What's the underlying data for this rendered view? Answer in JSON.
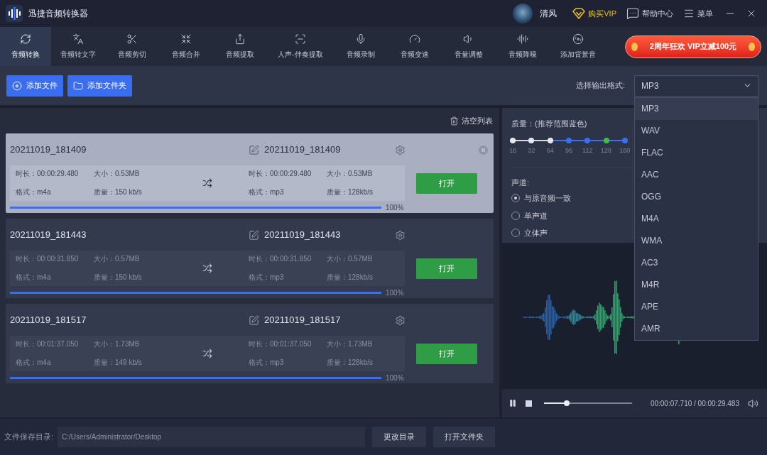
{
  "app": {
    "title": "迅捷音频转换器"
  },
  "user": {
    "name": "清风"
  },
  "header_links": [
    {
      "kind": "vip",
      "label": "购买VIP"
    },
    {
      "kind": "help",
      "label": "帮助中心"
    },
    {
      "kind": "menu",
      "label": "菜单"
    }
  ],
  "tabs": [
    {
      "label": "音频转换",
      "selected": true
    },
    {
      "label": "音频转文字",
      "selected": false
    },
    {
      "label": "音频剪切",
      "selected": false
    },
    {
      "label": "音频合并",
      "selected": false
    },
    {
      "label": "音频提取",
      "selected": false
    },
    {
      "label": "人声-伴奏提取",
      "selected": false
    },
    {
      "label": "音频录制",
      "selected": false
    },
    {
      "label": "音频变速",
      "selected": false
    },
    {
      "label": "音量调整",
      "selected": false
    },
    {
      "label": "音频降噪",
      "selected": false
    },
    {
      "label": "添加背景音",
      "selected": false
    }
  ],
  "promo": {
    "label": "2周年狂欢 VIP立减100元"
  },
  "actions": [
    {
      "kind": "add_file",
      "label": "添加文件"
    },
    {
      "kind": "add_folder",
      "label": "添加文件夹"
    }
  ],
  "format_select": {
    "label": "选择输出格式:",
    "value": "MP3",
    "expanded": true,
    "options": [
      {
        "label": "MP3",
        "selected": true
      },
      {
        "label": "WAV",
        "selected": false
      },
      {
        "label": "FLAC",
        "selected": false
      },
      {
        "label": "AAC",
        "selected": false
      },
      {
        "label": "OGG",
        "selected": false
      },
      {
        "label": "M4A",
        "selected": false
      },
      {
        "label": "WMA",
        "selected": false
      },
      {
        "label": "AC3",
        "selected": false
      },
      {
        "label": "M4R",
        "selected": false
      },
      {
        "label": "APE",
        "selected": false
      },
      {
        "label": "AMR",
        "selected": false
      }
    ]
  },
  "clear_list": {
    "label": "清空列表"
  },
  "files": [
    {
      "selected": true,
      "source": {
        "name": "20211019_181409",
        "duration": "时长：00:00:29.480",
        "size": "大小：0.53MB",
        "format": "格式：m4a",
        "quality": "质量：150 kb/s"
      },
      "output": {
        "name": "20211019_181409",
        "duration": "时长：00:00:29.480",
        "size": "大小：0.53MB",
        "format": "格式：mp3",
        "quality": "质量：128kb/s"
      },
      "open_button": "打开",
      "level": 1,
      "percent": "100%"
    },
    {
      "selected": false,
      "source": {
        "name": "20211019_181443",
        "duration": "时长：00:00:31.850",
        "size": "大小：0.57MB",
        "format": "格式：m4a",
        "quality": "质量：150 kb/s"
      },
      "output": {
        "name": "20211019_181443",
        "duration": "时长：00:00:31.850",
        "size": "大小：0.57MB",
        "format": "格式：mp3",
        "quality": "质量：128kb/s"
      },
      "open_button": "打开",
      "level": 1,
      "percent": "100%"
    },
    {
      "selected": false,
      "source": {
        "name": "20211019_181517",
        "duration": "时长：00:01:37.050",
        "size": "大小：1.73MB",
        "format": "格式：m4a",
        "quality": "质量：149 kb/s"
      },
      "output": {
        "name": "20211019_181517",
        "duration": "时长：00:01:37.050",
        "size": "大小：1.73MB",
        "format": "格式：mp3",
        "quality": "质量：128kb/s"
      },
      "open_button": "打开",
      "level": 1,
      "percent": "100%"
    }
  ],
  "quality": {
    "label": "质量：(推荐范围蓝色)",
    "ticks": [
      {
        "label": "16",
        "recommended": false,
        "selected": false
      },
      {
        "label": "32",
        "recommended": false,
        "selected": false
      },
      {
        "label": "64",
        "recommended": false,
        "selected": false
      },
      {
        "label": "96",
        "recommended": true,
        "selected": false
      },
      {
        "label": "112",
        "recommended": true,
        "selected": false
      },
      {
        "label": "128",
        "recommended": true,
        "selected": true
      },
      {
        "label": "160",
        "recommended": true,
        "selected": false
      }
    ]
  },
  "channel": {
    "label": "声道:",
    "options": [
      {
        "label": "与原音频一致",
        "selected": true
      },
      {
        "label": "单声道",
        "selected": false
      },
      {
        "label": "立体声",
        "selected": false
      }
    ]
  },
  "player": {
    "playing": true,
    "level": 0.26,
    "time": "00:00:07.710 / 00:00:29.483"
  },
  "save_dir": {
    "label": "文件保存目录:",
    "value": "C:/Users/Administrator/Desktop",
    "buttons": [
      "更改目录",
      "打开文件夹"
    ]
  }
}
